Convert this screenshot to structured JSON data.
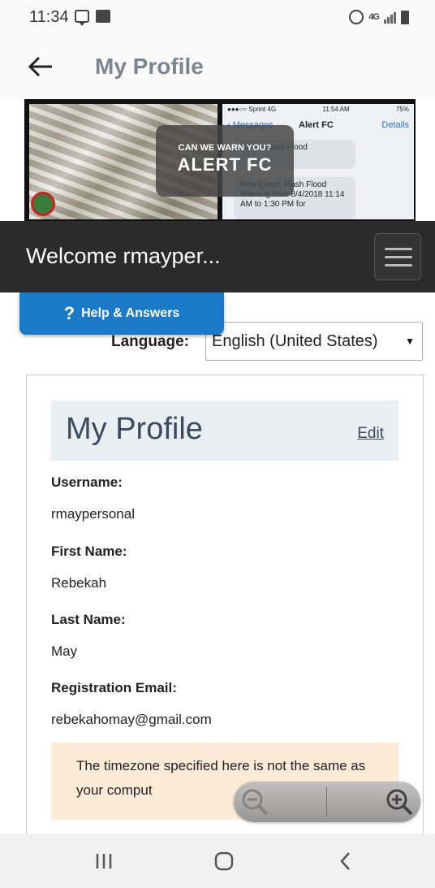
{
  "status_bar": {
    "time": "11:34",
    "lte": "4G",
    "icons": [
      "message-icon",
      "image-icon",
      "alarm-icon",
      "lte-icon",
      "signal-icon",
      "battery-icon"
    ]
  },
  "header": {
    "title": "My Profile",
    "back_icon": "back-arrow-icon"
  },
  "banner": {
    "overlay_subtitle": "CAN WE WARN YOU?",
    "overlay_title": "ALERT FC",
    "phone": {
      "carrier": "●●●○○ Sprint 4G",
      "time": "11:54 AM",
      "battery": "75%",
      "back_label": "‹ Messages",
      "title": "Alert FC",
      "details_label": "Details",
      "message_1": "...FC - Flash Flood",
      "message_2": "New Event: Flash Flood Warning from 8/4/2018 11:14 AM to 1:30 PM for"
    }
  },
  "navbar": {
    "welcome": "Welcome rmayper...",
    "menu_icon": "hamburger-menu-icon"
  },
  "help": {
    "label": "Help & Answers",
    "icon": "?"
  },
  "language": {
    "label": "Language:",
    "selected": "English (United States)",
    "caret": "▼"
  },
  "profile": {
    "title": "My Profile",
    "edit_label": "Edit",
    "fields": [
      {
        "label": "Username:",
        "value": "rmaypersonal"
      },
      {
        "label": "First Name:",
        "value": "Rebekah"
      },
      {
        "label": "Last Name:",
        "value": "May"
      },
      {
        "label": "Registration Email:",
        "value": "rebekahomay@gmail.com"
      }
    ],
    "timezone_notice": "The timezone specified here is not the same as your comput"
  },
  "zoom": {
    "zoom_out_icon": "zoom-out-icon",
    "zoom_in_icon": "zoom-in-icon"
  },
  "bottom_nav": {
    "recents_icon": "recents-icon",
    "home_icon": "home-icon",
    "back_icon": "back-icon"
  }
}
